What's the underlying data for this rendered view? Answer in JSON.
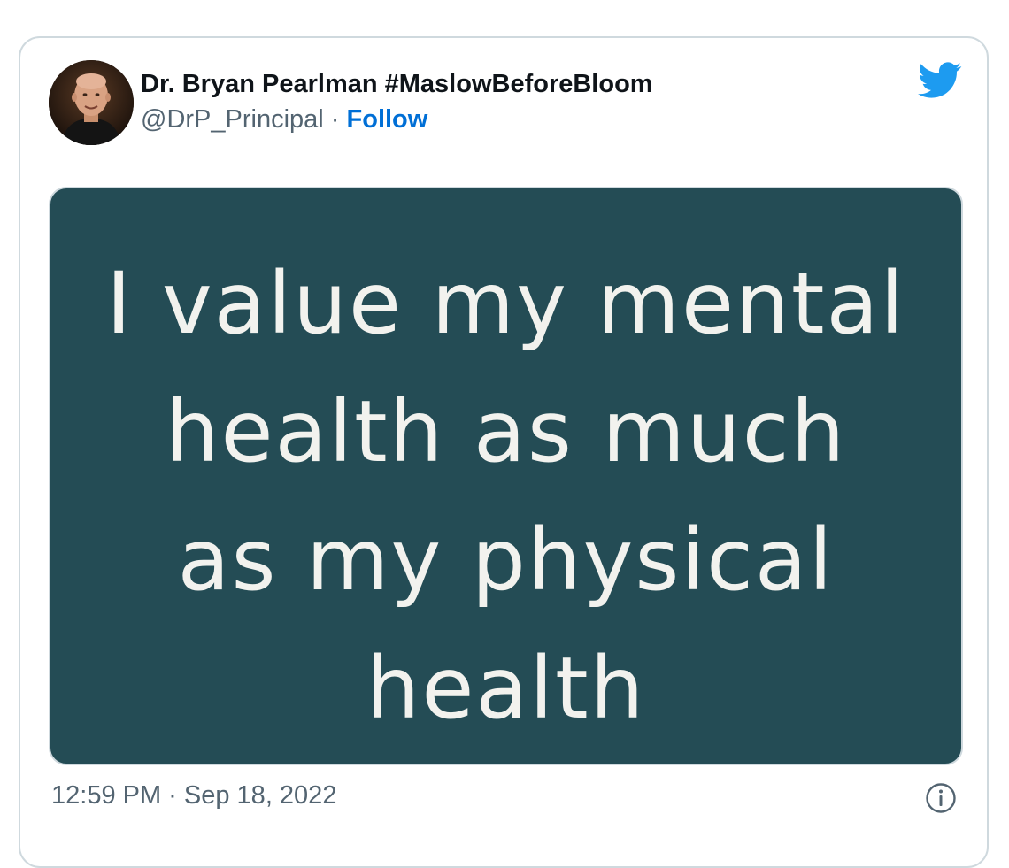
{
  "tweet": {
    "author_name": "Dr. Bryan Pearlman #MaslowBeforeBloom",
    "handle": "@DrP_Principal",
    "separator": " · ",
    "follow_label": "Follow",
    "media_text_lines": [
      "I value my mental",
      "health as much",
      "as my physical",
      "health"
    ],
    "timestamp": "12:59 PM · Sep 18, 2022"
  },
  "icons": {
    "brand": "twitter-bird-icon",
    "info": "info-icon"
  },
  "colors": {
    "twitter_blue": "#1d9bf0",
    "follow_link": "#006fd6",
    "media_background": "#244c55",
    "secondary_text": "#536471",
    "primary_text": "#0f1419",
    "border": "#cfd9de"
  }
}
